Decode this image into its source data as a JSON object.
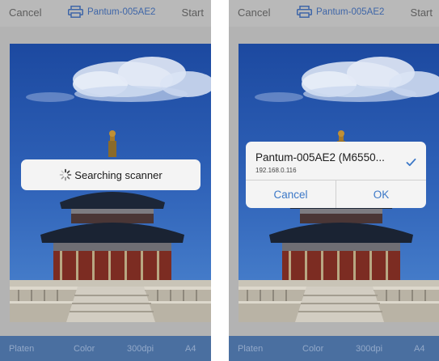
{
  "screens": [
    {
      "nav": {
        "cancel_label": "Cancel",
        "printer_name": "Pantum-005AE2",
        "start_label": "Start"
      },
      "toast": {
        "text": "Searching scanner",
        "icon": "spinner-icon"
      },
      "bottom_bar": {
        "source": "Platen",
        "color_mode": "Color",
        "resolution": "300dpi",
        "paper_size": "A4"
      }
    },
    {
      "nav": {
        "cancel_label": "Cancel",
        "printer_name": "Pantum-005AE2",
        "start_label": "Start"
      },
      "dialog": {
        "device_name": "Pantum-005AE2 (M6550...",
        "device_ip": "192.168.0.116",
        "cancel_label": "Cancel",
        "ok_label": "OK",
        "selected_icon": "checkmark-icon"
      },
      "bottom_bar": {
        "source": "Platen",
        "color_mode": "Color",
        "resolution": "300dpi",
        "paper_size": "A4"
      }
    }
  ],
  "colors": {
    "accent": "#3c78c7",
    "bottom_bar": "#4a6fa0",
    "overlay_gray": "#b3b3b3",
    "sky": "#2553a4"
  }
}
